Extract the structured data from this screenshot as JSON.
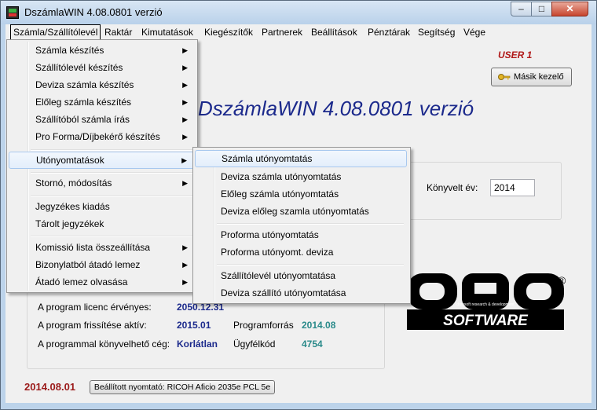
{
  "window": {
    "title": "DszámlaWIN 4.08.0801 verzió"
  },
  "menubar": [
    "Számla/Szállítólevél",
    "Raktár",
    "Kimutatások",
    "Kiegészítők",
    "Partnerek",
    "Beállítások",
    "Pénztárak",
    "Segítség",
    "Vége"
  ],
  "header": {
    "user": "USER 1",
    "switch_user": "Másik kezelő",
    "app_title": "DszámlaWIN 4.08.0801 verzió"
  },
  "year": {
    "label": "Könyvelt év:",
    "value": "2014"
  },
  "info": {
    "licence_label": "A program licenc érvényes:",
    "licence_value": "2050.12.31",
    "update_label": "A program frissítése aktív:",
    "update_value": "2015.01",
    "source_label": "Programforrás",
    "source_value": "2014.08",
    "company_label": "A programmal könyvelhető cég:",
    "company_value": "Korlátlan",
    "client_label": "Ügyfélkód",
    "client_value": "4754"
  },
  "footer": {
    "date": "2014.08.01",
    "printer": "Beállított nyomtató: RICOH Aficio 2035e PCL 5e"
  },
  "menu_main": {
    "items": [
      "Számla készítés",
      "Szállítólevél készítés",
      "Deviza számla készítés",
      "Előleg számla készítés",
      "Szállítóból számla írás",
      "Pro Forma/Díjbekérő készítés",
      "Utónyomtatások",
      "Stornó, módosítás",
      "Jegyzékes kiadás",
      "Tárolt jegyzékek",
      "Komissió lista összeállítása",
      "Bizonylatból átadó lemez",
      "Átadó lemez olvasása"
    ]
  },
  "menu_sub": {
    "items": [
      "Számla utónyomtatás",
      "Deviza számla utónyomtatás",
      "Előleg számla utónyomtatás",
      "Deviza előleg szamla utónyomtatás",
      "Proforma utónyomtatás",
      "Proforma utónyomt. deviza",
      "Szállítólevél utónyomtatása",
      "Deviza szállító utónyomtatása"
    ]
  },
  "logo": {
    "text1": "D R D",
    "text2": "SOFTWARE",
    "tagline": "datasoft research & development",
    "reg": "®"
  },
  "icons": {
    "submenu": "chevron-right-icon",
    "key": "key-icon",
    "app": "app-icon"
  }
}
